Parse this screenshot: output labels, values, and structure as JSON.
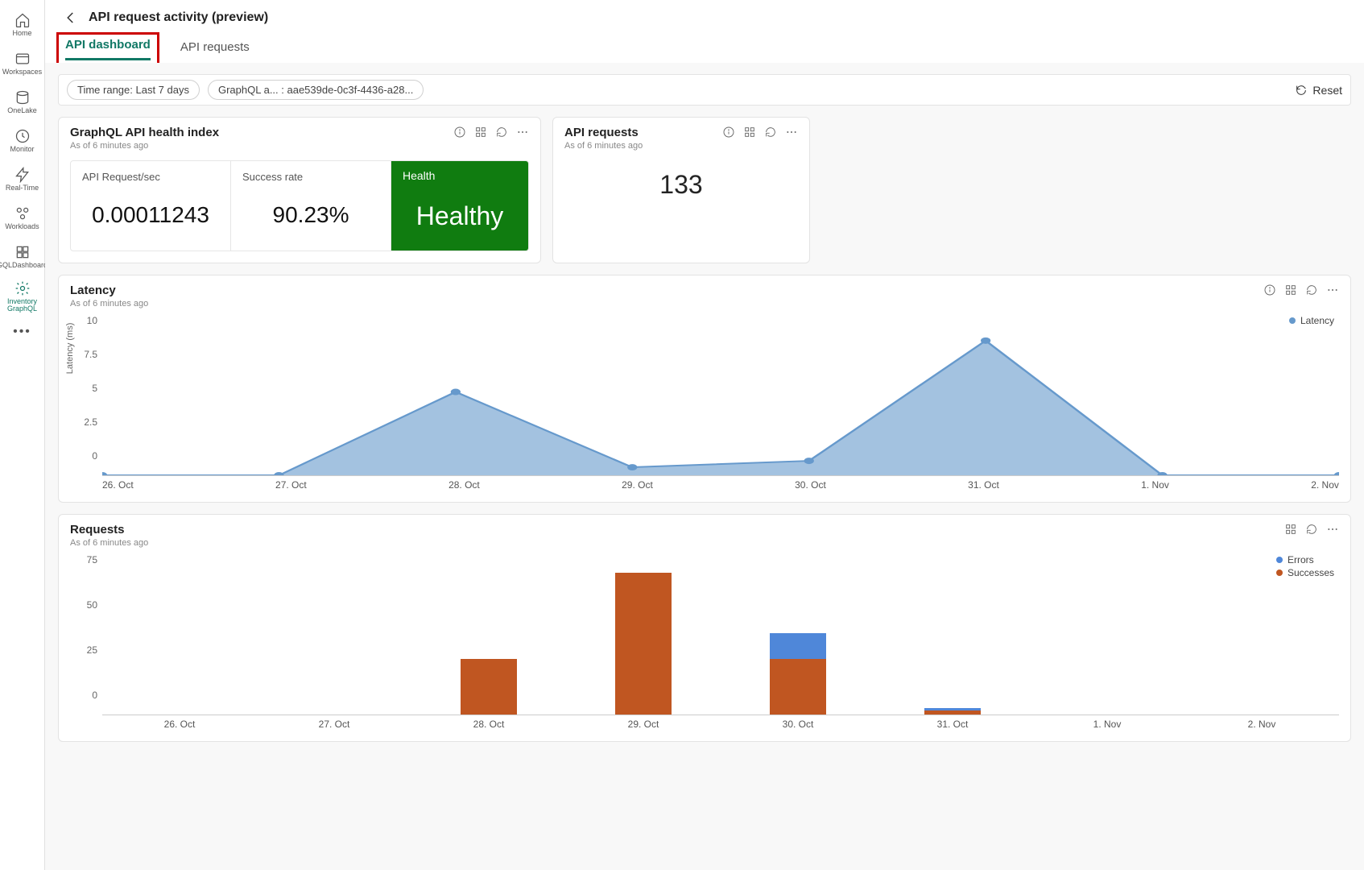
{
  "rail": {
    "items": [
      {
        "label": "Home",
        "icon": "home"
      },
      {
        "label": "Workspaces",
        "icon": "workspaces"
      },
      {
        "label": "OneLake",
        "icon": "onelake"
      },
      {
        "label": "Monitor",
        "icon": "monitor"
      },
      {
        "label": "Real-Time",
        "icon": "realtime"
      },
      {
        "label": "Workloads",
        "icon": "workloads"
      },
      {
        "label": "GQLDashboard",
        "icon": "gqldash"
      },
      {
        "label": "Inventory GraphQL",
        "icon": "inventory",
        "active": true
      }
    ]
  },
  "page": {
    "title": "API request activity (preview)",
    "tabs": [
      {
        "label": "API dashboard",
        "active": true,
        "highlighted": true
      },
      {
        "label": "API requests",
        "active": false
      }
    ]
  },
  "filters": {
    "time_range_label": "Time range: Last 7 days",
    "item_filter_label": "GraphQL a... : aae539de-0c3f-4436-a28...",
    "reset_label": "Reset"
  },
  "cards": {
    "health": {
      "title": "GraphQL API health index",
      "asof": "As of 6 minutes ago",
      "req_sec_label": "API Request/sec",
      "req_sec_value": "0.00011243",
      "success_label": "Success rate",
      "success_value": "90.23%",
      "health_label": "Health",
      "health_value": "Healthy"
    },
    "api_requests": {
      "title": "API requests",
      "asof": "As of 6 minutes ago",
      "value": "133"
    },
    "latency": {
      "title": "Latency",
      "asof": "As of 6 minutes ago"
    },
    "requests": {
      "title": "Requests",
      "asof": "As of 6 minutes ago"
    }
  },
  "chart_data": [
    {
      "name": "latency_chart",
      "type": "area",
      "title": "Latency",
      "ylabel": "Latency (ms)",
      "categories": [
        "26. Oct",
        "27. Oct",
        "28. Oct",
        "29. Oct",
        "30. Oct",
        "31. Oct",
        "1. Nov",
        "2. Nov"
      ],
      "y_ticks": [
        0,
        2.5,
        5,
        7.5,
        10
      ],
      "ylim": [
        0,
        10
      ],
      "series": [
        {
          "name": "Latency",
          "color": "#6699cc",
          "values": [
            0,
            0,
            5.2,
            0.5,
            0.9,
            8.4,
            0,
            0
          ]
        }
      ]
    },
    {
      "name": "requests_chart",
      "type": "bar",
      "title": "Requests",
      "categories": [
        "26. Oct",
        "27. Oct",
        "28. Oct",
        "29. Oct",
        "30. Oct",
        "31. Oct",
        "1. Nov",
        "2. Nov"
      ],
      "y_ticks": [
        0,
        25,
        50,
        75
      ],
      "ylim": [
        0,
        75
      ],
      "series": [
        {
          "name": "Errors",
          "color": "#4f87d9",
          "values": [
            0,
            0,
            0,
            0,
            12,
            1,
            0,
            0
          ]
        },
        {
          "name": "Successes",
          "color": "#c05621",
          "values": [
            0,
            0,
            26,
            66,
            26,
            2,
            0,
            0
          ]
        }
      ]
    }
  ]
}
